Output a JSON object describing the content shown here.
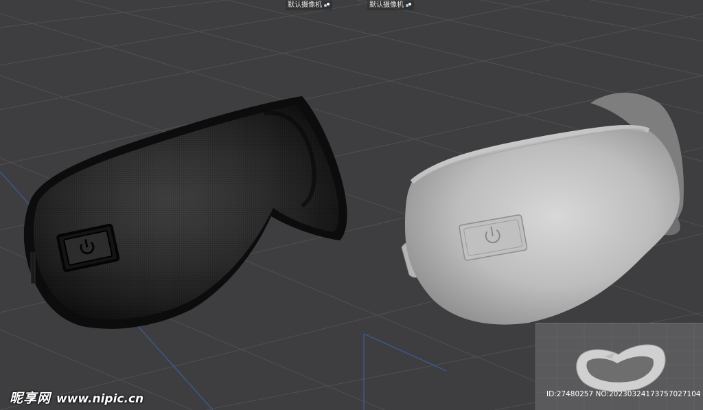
{
  "viewport": {
    "camera_labels": [
      "默认摄像机",
      "默认摄像机"
    ],
    "camera_icon": "camera-orbit-icon"
  },
  "models": {
    "left": {
      "name": "eye-mask-wireframe",
      "button_icon": "power-icon"
    },
    "right": {
      "name": "eye-mask-shaded",
      "button_icon": "power-icon"
    }
  },
  "inset": {
    "id_text": "ID:27480257 NO:20230324173757027104"
  },
  "watermark": {
    "brand": "昵享网",
    "url": "www.nipic.cn"
  },
  "colors": {
    "background": "#3e3e40",
    "grid": "#4e4e51",
    "axis": "#3a5f9e",
    "wire_dark": "#0c0c0c",
    "shaded_model": "#c8c8c8"
  }
}
